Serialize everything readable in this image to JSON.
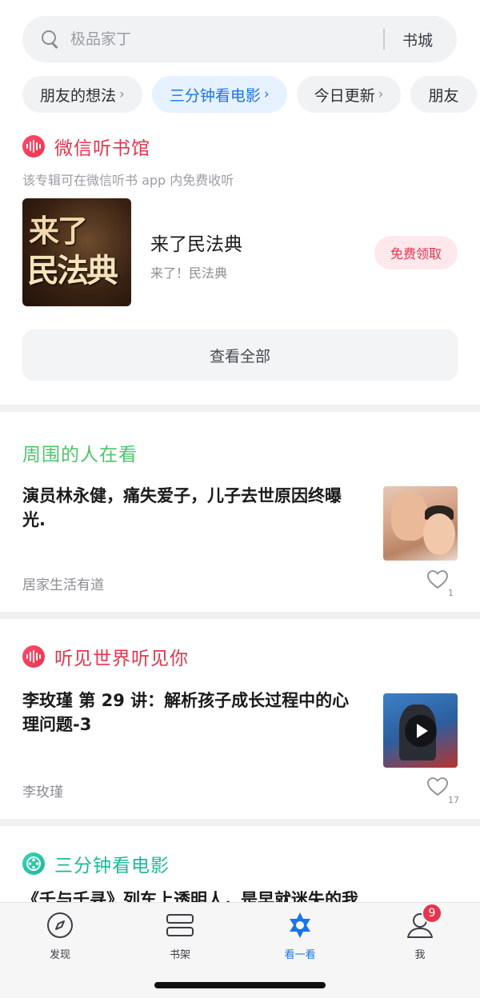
{
  "search": {
    "placeholder": "极品家丁",
    "bookstore_label": "书城"
  },
  "chips": [
    {
      "label": "朋友的想法"
    },
    {
      "label": "三分钟看电影"
    },
    {
      "label": "今日更新"
    },
    {
      "label": "朋友"
    }
  ],
  "wechat_listen": {
    "title": "微信听书馆",
    "subtitle": "该专辑可在微信听书 app 内免费收听",
    "album": {
      "cover_line1": "来了",
      "cover_line2": "民法典",
      "title": "来了民法典",
      "subtitle": "来了！民法典",
      "claim_label": "免费领取"
    },
    "view_all_label": "查看全部"
  },
  "nearby": {
    "title": "周围的人在看",
    "headline": "演员林永健，痛失爱子，儿子去世原因终曝光.",
    "source": "居家生活有道",
    "likes": "1"
  },
  "listen_world": {
    "title": "听见世界听见你",
    "headline": "李玫瑾 第 29 讲：解析孩子成长过程中的心理问题-3",
    "source": "李玫瑾",
    "likes": "17"
  },
  "movie": {
    "title": "三分钟看电影",
    "headline": "《千与千寻》列车上透明人，是早就迷失的我"
  },
  "tabbar": {
    "tabs": [
      {
        "label": "发现"
      },
      {
        "label": "书架"
      },
      {
        "label": "看一看"
      },
      {
        "label": "我"
      }
    ],
    "me_badge": "9"
  },
  "colors": {
    "accent_blue": "#1a73e8",
    "wechat_red": "#e5344d",
    "nearby_green": "#4cc46a",
    "movie_teal": "#1fb89a"
  }
}
